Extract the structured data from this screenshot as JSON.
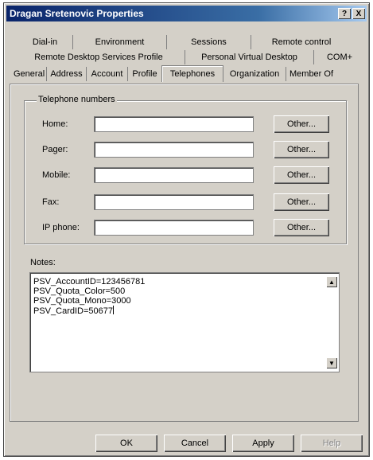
{
  "window": {
    "title": "Dragan Sretenovic Properties",
    "help_button": "?",
    "close_button": "X"
  },
  "tabs": {
    "row1": [
      "Dial-in",
      "Environment",
      "Sessions",
      "Remote control"
    ],
    "row2": [
      "Remote Desktop Services Profile",
      "Personal Virtual Desktop",
      "COM+"
    ],
    "row3": [
      "General",
      "Address",
      "Account",
      "Profile",
      "Telephones",
      "Organization",
      "Member Of"
    ],
    "active": "Telephones"
  },
  "telephone": {
    "group_label": "Telephone numbers",
    "fields": [
      {
        "label": "Home:",
        "value": "",
        "button": "Other..."
      },
      {
        "label": "Pager:",
        "value": "",
        "button": "Other..."
      },
      {
        "label": "Mobile:",
        "value": "",
        "button": "Other..."
      },
      {
        "label": "Fax:",
        "value": "",
        "button": "Other..."
      },
      {
        "label": "IP phone:",
        "value": "",
        "button": "Other..."
      }
    ]
  },
  "notes": {
    "label": "Notes:",
    "lines": [
      "PSV_AccountID=123456781",
      "PSV_Quota_Color=500",
      "PSV_Quota_Mono=3000",
      "PSV_CardID=50677"
    ]
  },
  "footer": {
    "ok": "OK",
    "cancel": "Cancel",
    "apply": "Apply",
    "help": "Help"
  },
  "icons": {
    "scroll_up": "scroll-up-arrow-icon",
    "scroll_down": "scroll-down-arrow-icon"
  }
}
